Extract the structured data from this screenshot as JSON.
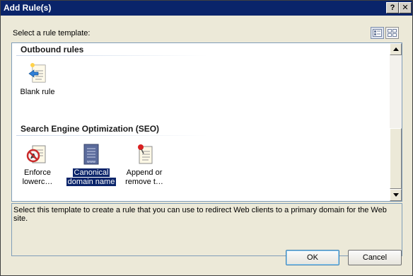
{
  "window": {
    "title": "Add Rule(s)",
    "help_glyph": "?",
    "close_glyph": "✕"
  },
  "prompt": "Select a rule template:",
  "view_buttons": [
    {
      "icon": "details-view-icon",
      "active": true
    },
    {
      "icon": "tiles-view-icon",
      "active": false
    }
  ],
  "groups": [
    {
      "heading": "Outbound rules",
      "items": [
        {
          "label": "Blank rule",
          "icon": "blank-rule-icon"
        }
      ]
    },
    {
      "heading": "Search Engine Optimization (SEO)",
      "items": [
        {
          "label_l1": "Enforce",
          "label_l2": "lowerc…",
          "icon": "enforce-lowercase-icon"
        },
        {
          "label_l1": "Canonical",
          "label_l2": "domain name",
          "icon": "canonical-domain-icon",
          "selected": true
        },
        {
          "label_l1": "Append or",
          "label_l2": "remove t…",
          "icon": "append-remove-slash-icon"
        }
      ]
    }
  ],
  "description": "Select this template to create a rule that you can use to redirect Web clients to a primary domain for the Web site.",
  "buttons": {
    "ok": "OK",
    "cancel": "Cancel"
  }
}
